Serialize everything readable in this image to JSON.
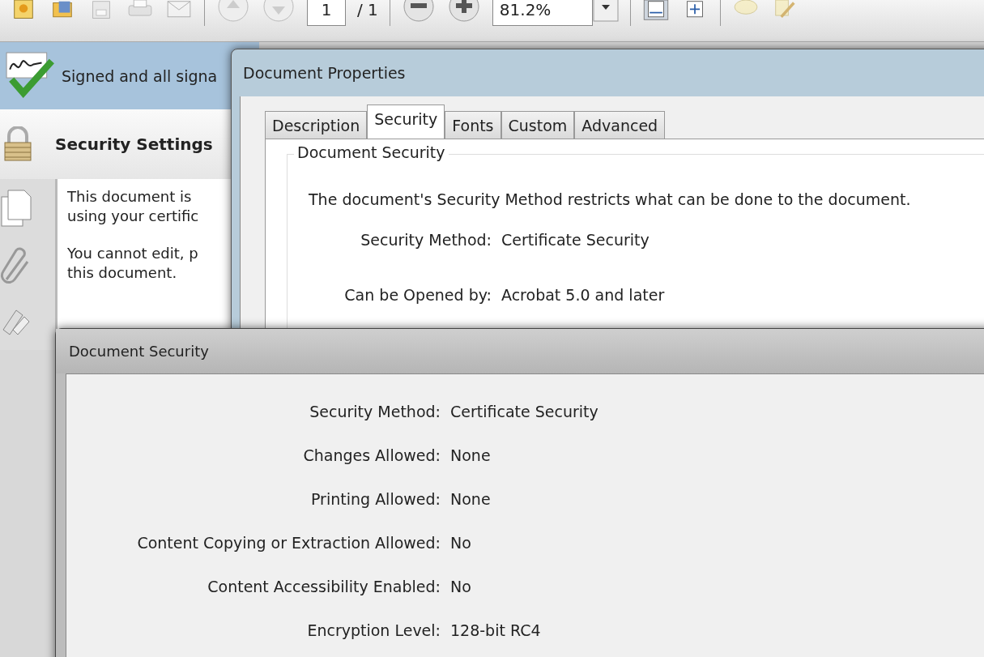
{
  "toolbar": {
    "page_number": "1",
    "page_count": "/ 1",
    "zoom": "81.2%"
  },
  "signature_bar": {
    "text": "Signed and all signa"
  },
  "security_panel": {
    "title": "Security Settings",
    "paragraphs": [
      [
        "This document is",
        "using your certific"
      ],
      [
        "You cannot edit, p",
        "this document."
      ]
    ]
  },
  "properties_dialog": {
    "title": "Document Properties",
    "tabs": [
      {
        "label": "Description",
        "selected": false
      },
      {
        "label": "Security",
        "selected": true
      },
      {
        "label": "Fonts",
        "selected": false
      },
      {
        "label": "Custom",
        "selected": false
      },
      {
        "label": "Advanced",
        "selected": false
      }
    ],
    "group_title": "Document Security",
    "intro": "The document's Security Method restricts what can be done to the document.",
    "fields": [
      {
        "label": "Security Method:",
        "value": "Certificate Security"
      },
      {
        "label": "Can be Opened by:",
        "value": "Acrobat 5.0 and later"
      }
    ]
  },
  "security_dialog": {
    "title": "Document Security",
    "fields": [
      {
        "label": "Security Method:",
        "value": "Certificate Security"
      },
      {
        "label": "Changes Allowed:",
        "value": "None"
      },
      {
        "label": "Printing Allowed:",
        "value": "None"
      },
      {
        "label": "Content Copying or Extraction Allowed:",
        "value": "No"
      },
      {
        "label": "Content Accessibility Enabled:",
        "value": "No"
      },
      {
        "label": "Encryption Level:",
        "value": "128-bit RC4"
      }
    ]
  }
}
